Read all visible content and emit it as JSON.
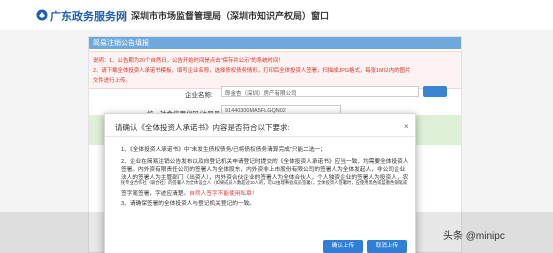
{
  "header": {
    "logo_text": "广东政务服务网",
    "title": "深圳市市场监督管理局（深圳市知识产权局）窗口"
  },
  "panel": {
    "header_title": "简易注销公告填报",
    "notice_lines": [
      "说明：1、公告期为20个自然日，公告开始时间是点击\"保存并公示\"的系统时间！",
      "2、请下载全体投资人承诺书模板，填写企业名称，选择债权债务情形，打印后全体投资人签署，扫描成JPG格式，每张1M以内的图片",
      "文件进行上传。"
    ],
    "company_label": "企业名称:",
    "company_value": "郎金杏（深圳）房产有限公司",
    "credit_label": "统一社会信用代码/注册号:",
    "credit_value": "91440300MA5FLGQN02"
  },
  "modal": {
    "title": "请确认《全体投资人承诺书》内容是否符合以下要求:",
    "close": "×",
    "item1": "1、《全体投资人承诺书》中\"未发生债权债务/已将债权债务清算完成\"只能二选一；",
    "item2_lines": [
      "2、企业在简易注销公告发布以及向登记机关申请登记时提交的《全体投资人承诺书》应当一致，均需要全体投资人",
      "签署。内外资有限责任公司的签署人为全体股东，内外资非上市股份有限公司的签署人为全体发起人，非公司企业",
      "法人的签署人为主管部门（出资人），内外资合伙企业的签署人为全体合伙人，个人独资企业的签署人为投资人，农",
      "民专业合作社（联合社）的签署人为全体设立人（如果成员人数超过10人的，可以由理事会成员签署）。全体投资人签署时，应使用黑色或蓝墨色钢笔或",
      "签字笔签署，字迹应清楚。"
    ],
    "item2_red": "自然人签字不能使用私章！",
    "item3": "3、请确保签署的全体投资人与登记机关登记的一致。",
    "confirm_button": "确认上传",
    "cancel_button": "取消上传"
  },
  "watermark": "头条 @minipc",
  "colors": {
    "brand_blue": "#1e5fb4",
    "primary_button": "#2f7ed8",
    "notice_red": "#d9322d",
    "panel_header": "#6fa8dc",
    "form_green": "#dff0d8"
  }
}
